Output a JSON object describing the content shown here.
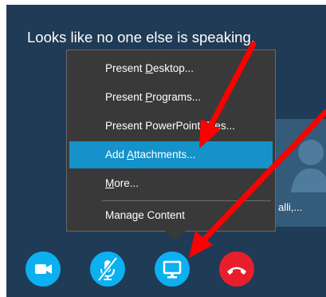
{
  "meeting": {
    "status_text": "Looks like no one else is speaking.",
    "participant_name_fragment": "alli,..."
  },
  "present_menu": {
    "items": [
      {
        "pre": "Present ",
        "key": "D",
        "post": "esktop..."
      },
      {
        "pre": "Present ",
        "key": "P",
        "post": "rograms..."
      },
      {
        "pre": "Present PowerPoint Files...",
        "key": "",
        "post": ""
      },
      {
        "pre": "Add ",
        "key": "A",
        "post": "ttachments..."
      },
      {
        "pre": "",
        "key": "M",
        "post": "ore..."
      },
      {
        "pre": "Manage Content",
        "key": "",
        "post": ""
      }
    ],
    "highlighted_index": 3
  },
  "controls": {
    "video_icon": "video-camera-icon",
    "mute_icon": "microphone-muted-icon",
    "present_icon": "monitor-icon",
    "hangup_icon": "phone-hangup-icon"
  },
  "colors": {
    "meeting_bg": "#1f3b55",
    "menu_bg": "#393939",
    "highlight": "#1492c9",
    "control_blue": "#0cb0f0",
    "control_red": "#e81f2b",
    "annotation_arrow": "#ff0000"
  }
}
